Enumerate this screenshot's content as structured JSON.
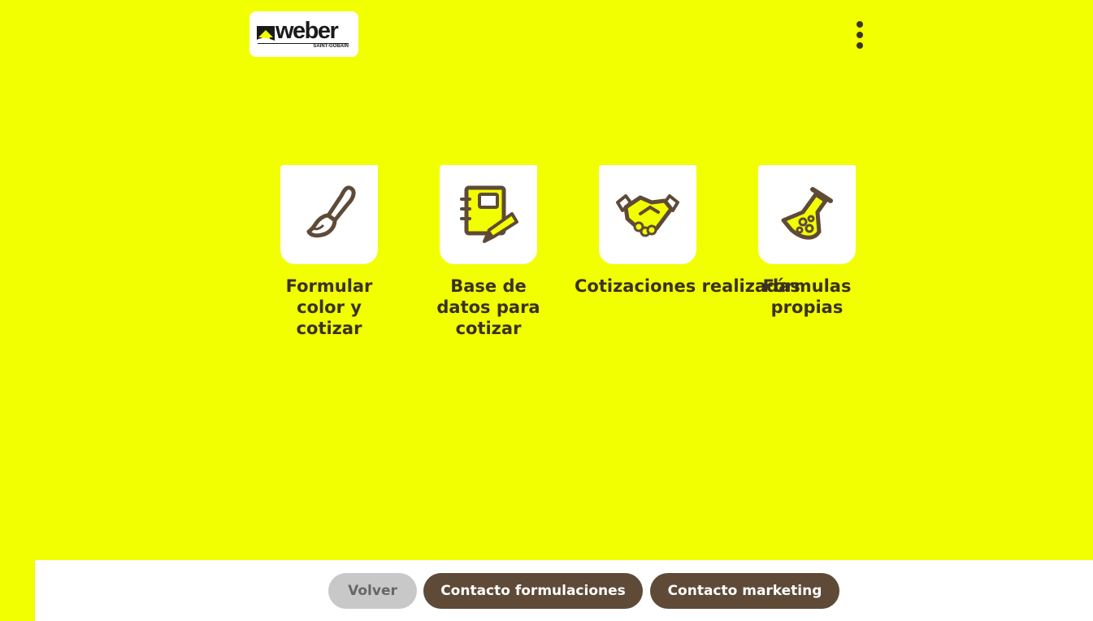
{
  "header": {
    "logo_text": "weber",
    "logo_subtext": "SAINT-GOBAIN",
    "menu_icon": "kebab-menu-icon"
  },
  "tiles": [
    {
      "label": "Formular color y cotizar",
      "icon": "paintbrush-icon"
    },
    {
      "label": "Base de datos para cotizar",
      "icon": "notebook-pencil-icon"
    },
    {
      "label": "Cotizaciones realizadas",
      "icon": "handshake-icon"
    },
    {
      "label": "Fórmulas propias",
      "icon": "flask-icon"
    }
  ],
  "footer": {
    "back_label": "Volver",
    "formulations_label": "Contacto formulaciones",
    "marketing_label": "Contacto marketing"
  },
  "colors": {
    "background": "#f2ff00",
    "brown": "#5e4a37",
    "text_dark": "#3a3122",
    "button_disabled": "#c8c8c8"
  }
}
